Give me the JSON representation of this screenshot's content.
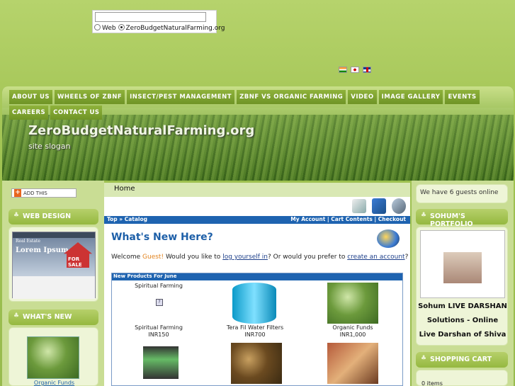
{
  "search": {
    "placeholder": "",
    "option_web": "Web",
    "option_site": "ZeroBudgetNaturalFarming.org"
  },
  "menu": [
    "ABOUT US",
    "WHEELS OF ZBNF",
    "INSECT/PEST MANAGEMENT",
    "ZBNF VS ORGANIC FARMING",
    "VIDEO",
    "IMAGE GALLERY",
    "EVENTS",
    "CAREERS",
    "CONTACT US"
  ],
  "site": {
    "name": "ZeroBudgetNaturalFarming.org",
    "slogan": "site slogan"
  },
  "left": {
    "addthis": "ADD THIS",
    "web_design": "WEB DESIGN",
    "whats_new": "WHAT'S NEW",
    "new_item": "Organic Funds"
  },
  "ad": {
    "brand": "Real Estate",
    "headline": "Lorem Ipsum",
    "badge": "FOR SALE"
  },
  "main": {
    "breadcrumb": "Home",
    "bar_left": "Top » Catalog",
    "bar_right": "My Account  |  Cart Contents  |  Checkout",
    "heading": "What's New Here?",
    "welcome_prefix": "Welcome ",
    "guest": "Guest!",
    "welcome_mid": " Would you like to ",
    "login_link": "log yourself in",
    "welcome_or": "? Or would you prefer to ",
    "account_link": "create an account",
    "welcome_end": "?",
    "new_products_head": "New Products For June",
    "products": [
      {
        "top": "Spiritual Farming",
        "name": "Spiritual Farming",
        "price": "INR150"
      },
      {
        "name": "Tera Fil Water Filters",
        "price": "INR700"
      },
      {
        "name": "Organic Funds",
        "price": "INR1,000"
      }
    ]
  },
  "right": {
    "guests": "We have 6 guests online",
    "portfolio": "SOHUM'S PORTFOLIO",
    "portfolio_text": "Sohum LIVE DARSHAN Solutions - Online Live Darshan of Shiva",
    "cart": "SHOPPING CART",
    "cart_items": "0 items"
  },
  "colors": {
    "accent": "#1e63b0",
    "menu": "#7fa32f",
    "panel": "#eef5d7"
  }
}
